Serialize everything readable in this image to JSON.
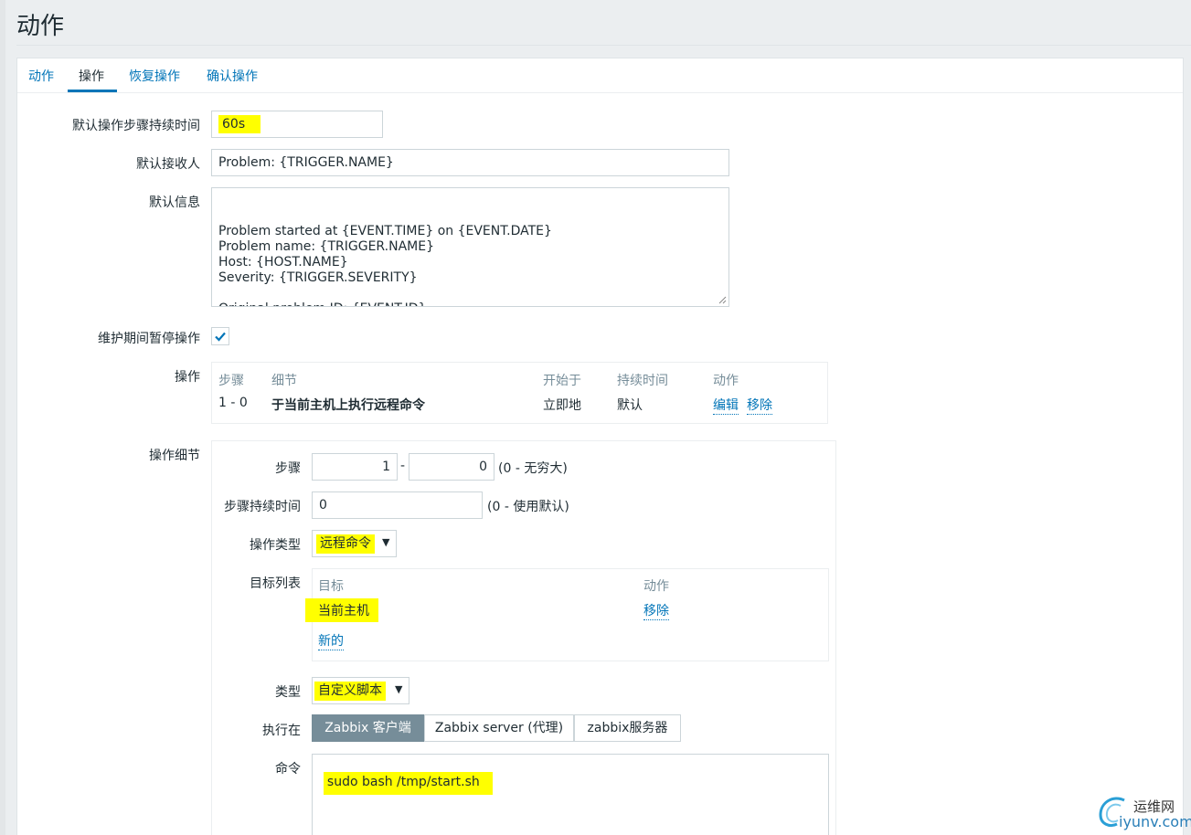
{
  "page": {
    "title": "动作"
  },
  "tabs": [
    {
      "label": "动作",
      "active": false
    },
    {
      "label": "操作",
      "active": true
    },
    {
      "label": "恢复操作",
      "active": false
    },
    {
      "label": "确认操作",
      "active": false
    }
  ],
  "form": {
    "default_step_duration": {
      "label": "默认操作步骤持续时间",
      "value": "60s"
    },
    "default_subject": {
      "label": "默认接收人",
      "value": "Problem: {TRIGGER.NAME}"
    },
    "default_message": {
      "label": "默认信息",
      "value": "Problem started at {EVENT.TIME} on {EVENT.DATE}\nProblem name: {TRIGGER.NAME}\nHost: {HOST.NAME}\nSeverity: {TRIGGER.SEVERITY}\n\nOriginal problem ID: {EVENT.ID}\n{TRIGGER.URL}"
    },
    "pause_in_maintenance": {
      "label": "维护期间暂停操作",
      "checked": true
    }
  },
  "operations": {
    "label": "操作",
    "headers": [
      "步骤",
      "细节",
      "开始于",
      "持续时间",
      "动作"
    ],
    "rows": [
      {
        "steps": "1 - 0",
        "details": "于当前主机上执行远程命令",
        "start_in": "立即地",
        "duration": "默认",
        "edit": "编辑",
        "remove": "移除"
      }
    ]
  },
  "operation_details": {
    "label": "操作细节",
    "steps": {
      "label": "步骤",
      "from": "1",
      "separator": "-",
      "to": "0",
      "hint": "(0 - 无穷大)"
    },
    "step_duration": {
      "label": "步骤持续时间",
      "value": "0",
      "hint": "(0 - 使用默认)"
    },
    "operation_type": {
      "label": "操作类型",
      "value": "远程命令"
    },
    "target_list": {
      "label": "目标列表",
      "headers": [
        "目标",
        "动作"
      ],
      "rows": [
        {
          "target": "当前主机",
          "action": "移除"
        }
      ],
      "new_link": "新的"
    },
    "type": {
      "label": "类型",
      "value": "自定义脚本"
    },
    "execute_on": {
      "label": "执行在",
      "options": [
        {
          "label": "Zabbix 客户端",
          "active": true
        },
        {
          "label": "Zabbix server (代理)",
          "active": false
        },
        {
          "label": "zabbix服务器",
          "active": false
        }
      ]
    },
    "commands": {
      "label": "命令",
      "value": "sudo bash /tmp/start.sh"
    }
  },
  "watermark": {
    "text_cn": "运维网",
    "text_url": "iyunv.com"
  },
  "colors": {
    "accent": "#0275b8",
    "highlight": "#ffff00",
    "segment_active": "#768d99"
  }
}
